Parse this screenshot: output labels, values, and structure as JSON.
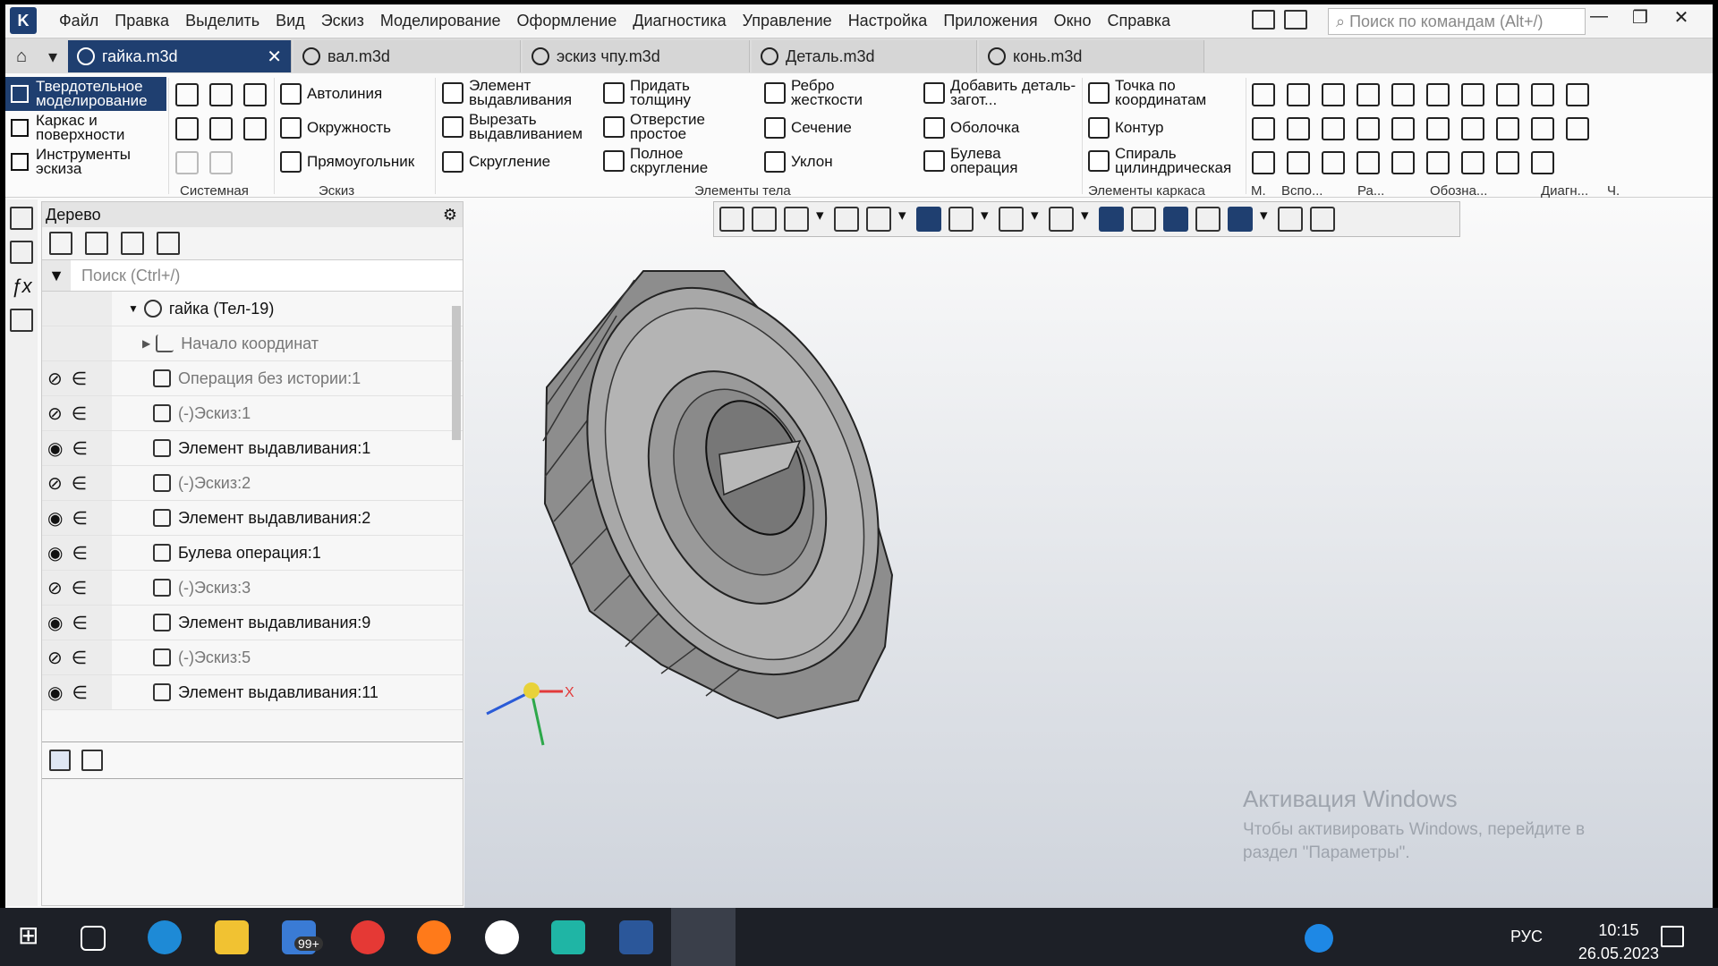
{
  "menu": [
    "Файл",
    "Правка",
    "Выделить",
    "Вид",
    "Эскиз",
    "Моделирование",
    "Оформление",
    "Диагностика",
    "Управление",
    "Настройка",
    "Приложения",
    "Окно",
    "Справка"
  ],
  "command_search": {
    "placeholder": "Поиск по командам (Alt+/)"
  },
  "tabs": [
    {
      "label": "гайка.m3d",
      "active": true
    },
    {
      "label": "вал.m3d"
    },
    {
      "label": "эскиз чпу.m3d"
    },
    {
      "label": "Деталь.m3d"
    },
    {
      "label": "конь.m3d"
    }
  ],
  "modes": [
    "Твердотельное моделирование",
    "Каркас и поверхности",
    "Инструменты эскиза"
  ],
  "ribbon": {
    "sketch": [
      "Автолиния",
      "Окружность",
      "Прямоугольник"
    ],
    "body1": [
      "Элемент выдавливания",
      "Вырезать выдавливанием",
      "Скругление"
    ],
    "body2": [
      "Придать толщину",
      "Отверстие простое",
      "Полное скругление"
    ],
    "body3": [
      "Ребро жесткости",
      "Сечение",
      "Уклон"
    ],
    "body4": [
      "Добавить деталь-загот...",
      "Оболочка",
      "Булева операция"
    ],
    "frame": [
      "Точка по координатам",
      "Контур",
      "Спираль цилиндрическая"
    ]
  },
  "groups": {
    "system": "Системная",
    "sketch": "Эскиз",
    "body": "Элементы тела",
    "frame": "Элементы каркаса",
    "m": "М.",
    "aux": "Вспо...",
    "ra": "Ра...",
    "desig": "Обозна...",
    "diag": "Диагн...",
    "ch": "Ч."
  },
  "panel": {
    "title": "Дерево",
    "search_placeholder": "Поиск (Ctrl+/)"
  },
  "tree": {
    "root": "гайка (Тел-19)",
    "origin": "Начало координат",
    "rows": [
      {
        "label": "Операция без истории:1",
        "hidden": true
      },
      {
        "label": "(-)Эскиз:1",
        "hidden": true
      },
      {
        "label": "Элемент выдавливания:1",
        "hidden": false
      },
      {
        "label": "(-)Эскиз:2",
        "hidden": true
      },
      {
        "label": "Элемент выдавливания:2",
        "hidden": false
      },
      {
        "label": "Булева операция:1",
        "hidden": false
      },
      {
        "label": "(-)Эскиз:3",
        "hidden": true
      },
      {
        "label": "Элемент выдавливания:9",
        "hidden": false
      },
      {
        "label": "(-)Эскиз:5",
        "hidden": true
      },
      {
        "label": "Элемент выдавливания:11",
        "hidden": false
      }
    ]
  },
  "watermark": {
    "title": "Активация Windows",
    "text": "Чтобы активировать Windows, перейдите в раздел \"Параметры\"."
  },
  "axis_x": "X",
  "taskbar": {
    "lang": "РУС",
    "time": "10:15",
    "date": "26.05.2023",
    "mail_badge": "99+"
  }
}
